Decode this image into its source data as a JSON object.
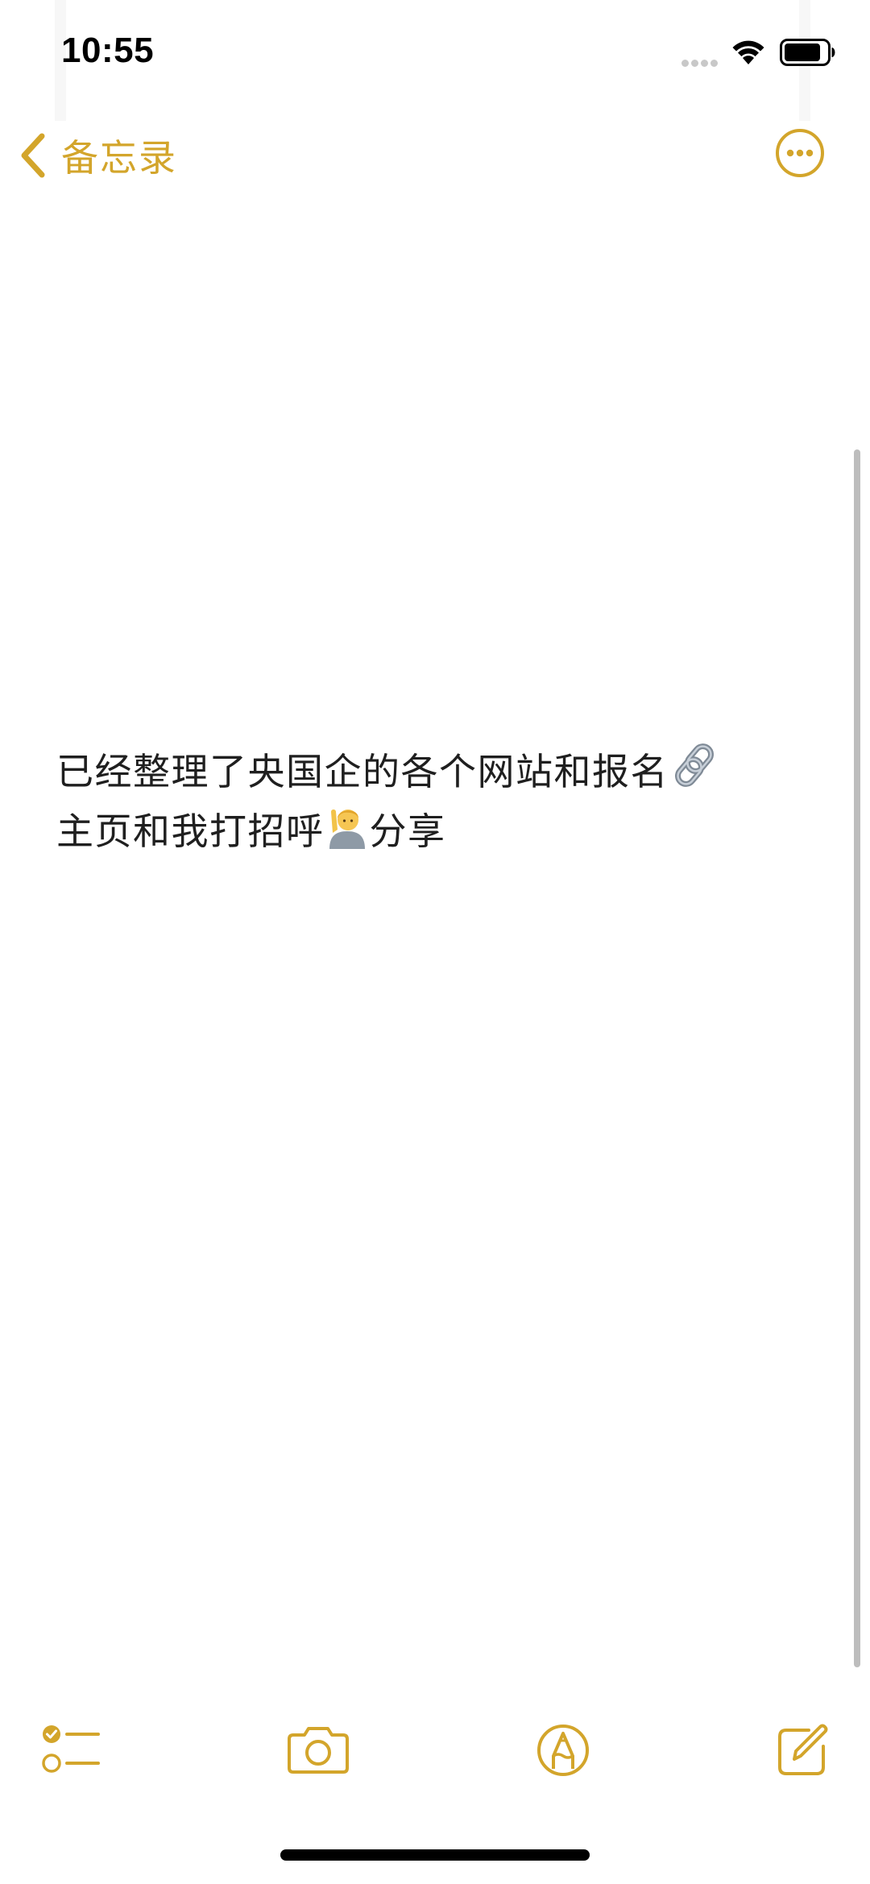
{
  "status_bar": {
    "time": "10:55",
    "wifi_icon": "wifi-icon",
    "battery_icon": "battery-icon"
  },
  "nav": {
    "back_label": "备忘录",
    "back_icon": "chevron-left-icon",
    "more_icon": "ellipsis-circle-icon"
  },
  "note": {
    "line1_text": "已经整理了央国企的各个网站和报名",
    "line1_emoji": "link-icon",
    "line2_text_a": "主页和我打招呼",
    "line2_emoji": "person-raising-hand-icon",
    "line2_text_b": "分享"
  },
  "toolbar": {
    "checklist_icon": "checklist-icon",
    "camera_icon": "camera-icon",
    "markup_icon": "markup-pen-icon",
    "compose_icon": "compose-icon"
  },
  "colors": {
    "accent": "#d3a52b",
    "text": "#1f1f1f",
    "background": "#ffffff"
  }
}
